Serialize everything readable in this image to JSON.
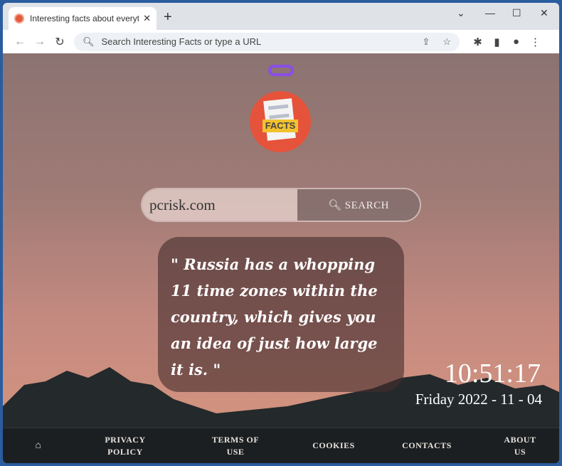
{
  "browser": {
    "tab_title": "Interesting facts about everything",
    "address_placeholder": "Search Interesting Facts or type a URL"
  },
  "page": {
    "search_value": "pcrisk.com",
    "search_button": "SEARCH",
    "logo_text": "FACTS",
    "quote": "\"  Russia has a whopping 11 time zones within the country, which gives you an idea of just how large it is. \"",
    "time": "10:51:17",
    "date": "Friday 2022 - 11 - 04",
    "footer": [
      {
        "label": "PRIVACY POLICY"
      },
      {
        "label": "TERMS OF USE"
      },
      {
        "label": "COOKIES"
      },
      {
        "label": "CONTACTS"
      },
      {
        "label": "ABOUT US"
      }
    ],
    "accent": "#8a4ee8"
  }
}
